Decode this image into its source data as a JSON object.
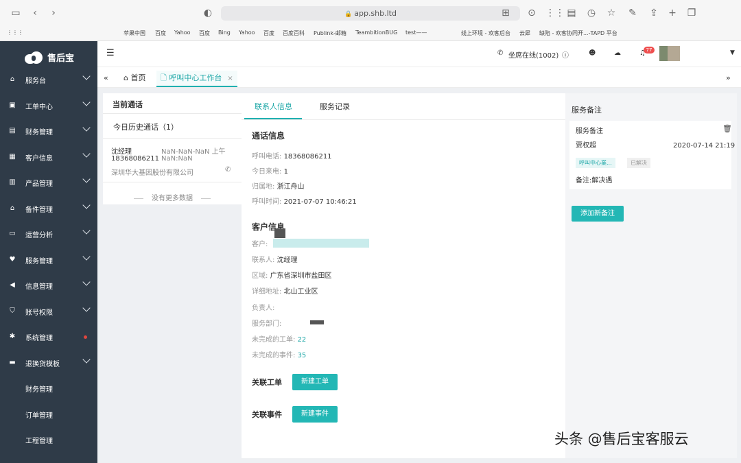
{
  "browser": {
    "url": "app.shb.ltd",
    "bookmarks": [
      "苹果中国",
      "百度",
      "Yahoo",
      "百度",
      "Bing",
      "Yahoo",
      "百度",
      "百度百科",
      "Publink-邮箱",
      "TeambitionBUG",
      "test——",
      "线上环境 - 欢客后台",
      "云犀",
      "缺陷 - 欢客协同开...-TAPD 平台"
    ]
  },
  "app": {
    "logo_text": "售后宝",
    "nav": [
      {
        "label": "服务台",
        "icon": "home-icon"
      },
      {
        "label": "工单中心",
        "icon": "clipboard-icon"
      },
      {
        "label": "财务管理",
        "icon": "finance-icon"
      },
      {
        "label": "客户信息",
        "icon": "contact-icon"
      },
      {
        "label": "产品管理",
        "icon": "box-icon"
      },
      {
        "label": "备件管理",
        "icon": "home-icon"
      },
      {
        "label": "运营分析",
        "icon": "monitor-icon"
      },
      {
        "label": "服务管理",
        "icon": "heart-icon"
      },
      {
        "label": "信息管理",
        "icon": "megaphone-icon"
      },
      {
        "label": "账号权限",
        "icon": "shield-icon"
      },
      {
        "label": "系统管理",
        "icon": "gear-icon"
      },
      {
        "label": "退换货模板",
        "icon": "template-icon"
      }
    ],
    "sub_nav": [
      "财务管理",
      "订单管理",
      "工程管理"
    ]
  },
  "header": {
    "seat_status": "坐席在线(1002)",
    "notification_count": "77"
  },
  "tabs": {
    "home": "首页",
    "workbench": "呼叫中心工作台",
    "close": "×"
  },
  "calls": {
    "current_title": "当前通话",
    "history_title": "今日历史通话（1）",
    "record": {
      "name": "沈经理",
      "time_line1": "NaN-NaN-NaN 上午",
      "phone": "18368086211",
      "time_line2": "NaN:NaN",
      "company": "深圳华大基因股份有限公司"
    },
    "no_more": "没有更多数据"
  },
  "main": {
    "tab_contact": "联系人信息",
    "tab_service": "服务记录",
    "call_info_title": "通话信息",
    "call_info": [
      {
        "k": "呼叫电话:",
        "v": "18368086211"
      },
      {
        "k": "今日来电:",
        "v": "1"
      },
      {
        "k": "归属地:",
        "v": "浙江舟山"
      },
      {
        "k": "呼叫时间:",
        "v": "2021-07-07 10:46:21"
      }
    ],
    "customer_title": "客户信息",
    "customer": [
      {
        "k": "客户:",
        "v": ""
      },
      {
        "k": "联系人:",
        "v": "沈经理"
      },
      {
        "k": "区域:",
        "v": "广东省深圳市盐田区"
      },
      {
        "k": "详细地址:",
        "v": "北山工业区"
      },
      {
        "k": "负责人:",
        "v": ""
      },
      {
        "k": "服务部门:",
        "v": ""
      },
      {
        "k": "未完成的工单:",
        "v": "22"
      },
      {
        "k": "未完成的事件:",
        "v": "35"
      }
    ],
    "related_orders": "关联工单",
    "new_order_btn": "新建工单",
    "related_events": "关联事件",
    "new_event_btn": "新建事件"
  },
  "notes": {
    "title": "服务备注",
    "card_title": "服务备注",
    "author": "贾权超",
    "datetime": "2020-07-14 21:19",
    "tag_category": "呼叫中心業...",
    "tag_status": "已解决",
    "content": "备注:解决遇",
    "add_btn": "添加新备注"
  },
  "watermark": "头条 @售后宝客服云",
  "colors": {
    "accent": "#23b7b5",
    "sidebar": "#2f3b48",
    "badge": "#ef4f4f"
  }
}
